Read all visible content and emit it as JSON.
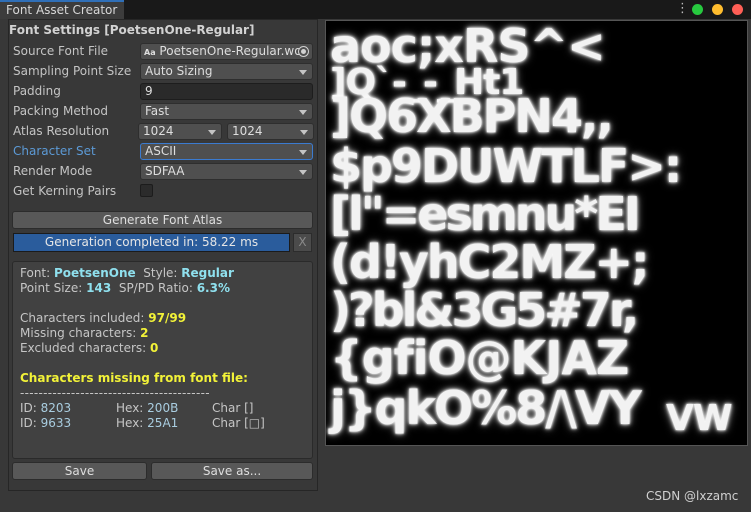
{
  "window": {
    "tab_title": "Font Asset Creator",
    "menu_icon": "kebab-menu-icon",
    "traffic_lights": {
      "green": "#27c93f",
      "yellow": "#ffbd2e",
      "red": "#ff5f56"
    }
  },
  "settings": {
    "header": "Font Settings [PoetsenOne-Regular]",
    "source_font_file": {
      "label": "Source Font File",
      "value": "PoetsenOne-Regular.wo",
      "prefix_icon_text": "Aa",
      "picker_icon": "object-picker-icon"
    },
    "sampling_point_size": {
      "label": "Sampling Point Size",
      "value": "Auto Sizing"
    },
    "padding": {
      "label": "Padding",
      "value": "9"
    },
    "packing_method": {
      "label": "Packing Method",
      "value": "Fast"
    },
    "atlas_resolution": {
      "label": "Atlas Resolution",
      "width": "1024",
      "height": "1024"
    },
    "character_set": {
      "label": "Character Set",
      "value": "ASCII"
    },
    "render_mode": {
      "label": "Render Mode",
      "value": "SDFAA"
    },
    "get_kerning_pairs": {
      "label": "Get Kerning Pairs",
      "checked": false
    }
  },
  "generate_button": "Generate Font Atlas",
  "progress": {
    "text": "Generation completed in: 58.22 ms",
    "fraction": 1.0,
    "cancel_label": "X"
  },
  "info": {
    "font_label": "Font:",
    "font_value": "PoetsenOne",
    "style_label": "Style:",
    "style_value": "Regular",
    "point_size_label": "Point Size:",
    "point_size_value": "143",
    "ratio_label": "SP/PD Ratio:",
    "ratio_value": "6.3%",
    "included_label": "Characters included:",
    "included_value": "97/99",
    "missing_label": "Missing characters:",
    "missing_value": "2",
    "excluded_label": "Excluded characters:",
    "excluded_value": "0",
    "missing_title": "Characters missing from font file:",
    "divider": "-----------------------------------------",
    "missing_rows": [
      {
        "id_label": "ID:",
        "id": "8203",
        "hex_label": "Hex:",
        "hex": "200B",
        "char_label": "Char []"
      },
      {
        "id_label": "ID:",
        "id": "9633",
        "hex_label": "Hex:",
        "hex": "25A1",
        "char_label": "Char [□]"
      }
    ]
  },
  "buttons": {
    "save": "Save",
    "save_as": "Save as..."
  },
  "atlas_glyphs": [
    "aoc;xRS^<",
    "]Q`-_-_Ht1",
    "]Q6XBPN4,,",
    "$p9DUWTLF>:",
    "[l\"=esmnu*EI",
    "(d!yhC2MZ+;",
    ")?bl&3G5#7r,",
    "{gfiO@KJAZ",
    "j}qkO%8/\\VY",
    "VW"
  ],
  "watermark": "CSDN @lxzamc"
}
